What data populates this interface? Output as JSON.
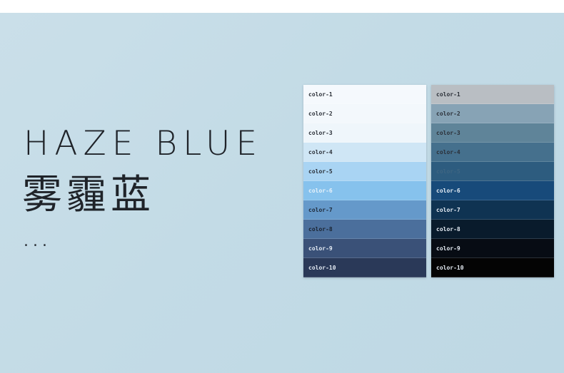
{
  "title_en": "HAZE BLUE",
  "title_cn": "雾霾蓝",
  "ellipsis": "...",
  "palette_light": [
    {
      "label": "color-1",
      "color": "#f5f9fd",
      "text": "#2b3038"
    },
    {
      "label": "color-2",
      "color": "#f3f8fc",
      "text": "#2b3038"
    },
    {
      "label": "color-3",
      "color": "#eff6fb",
      "text": "#2b3038"
    },
    {
      "label": "color-4",
      "color": "#cfe6f5",
      "text": "#2b3038"
    },
    {
      "label": "color-5",
      "color": "#a9d4f3",
      "text": "#2b3038"
    },
    {
      "label": "color-6",
      "color": "#86c2ed",
      "text": "#e8f2fa"
    },
    {
      "label": "color-7",
      "color": "#6599ca",
      "text": "#1f2a3a"
    },
    {
      "label": "color-8",
      "color": "#4b6f9c",
      "text": "#1a2330"
    },
    {
      "label": "color-9",
      "color": "#3a5178",
      "text": "#e6edf5"
    },
    {
      "label": "color-10",
      "color": "#2a3958",
      "text": "#e6edf5"
    }
  ],
  "palette_dark": [
    {
      "label": "color-1",
      "color": "#b9bec3",
      "text": "#2b3038"
    },
    {
      "label": "color-2",
      "color": "#87a3b5",
      "text": "#2b3038"
    },
    {
      "label": "color-3",
      "color": "#5f8499",
      "text": "#2b3038"
    },
    {
      "label": "color-4",
      "color": "#45708d",
      "text": "#2b3038"
    },
    {
      "label": "color-5",
      "color": "#2d5c7f",
      "text": "#3e6582"
    },
    {
      "label": "color-6",
      "color": "#174a7a",
      "text": "#e6edf5"
    },
    {
      "label": "color-7",
      "color": "#0f3352",
      "text": "#e6edf5"
    },
    {
      "label": "color-8",
      "color": "#091b2c",
      "text": "#e6edf5"
    },
    {
      "label": "color-9",
      "color": "#070c14",
      "text": "#e6edf5"
    },
    {
      "label": "color-10",
      "color": "#040404",
      "text": "#e6edf5"
    }
  ]
}
